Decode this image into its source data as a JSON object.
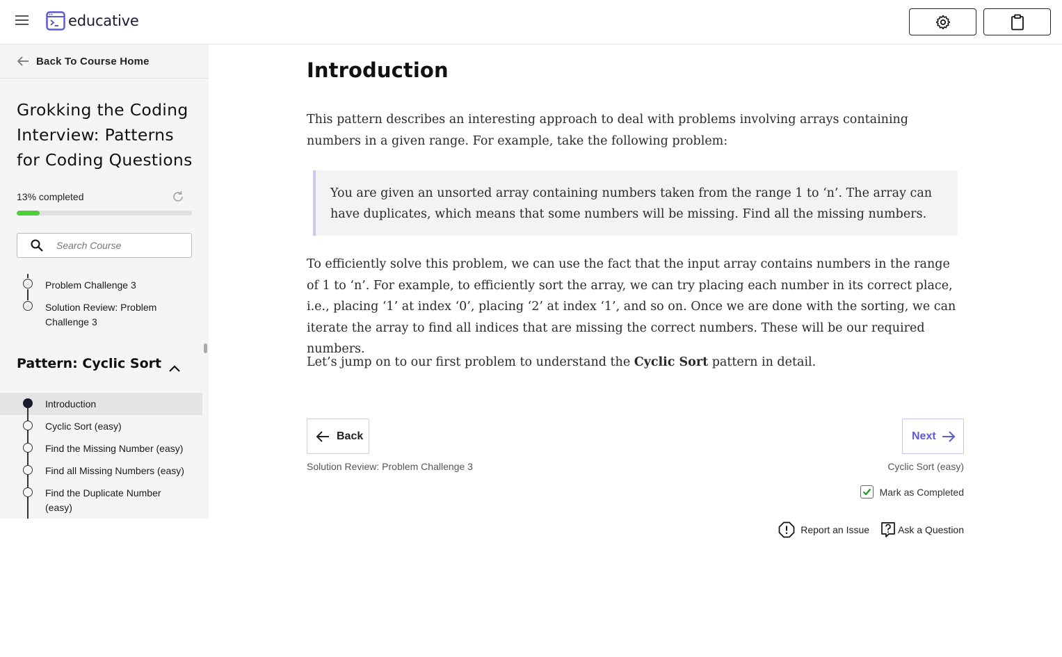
{
  "header": {
    "brand": "educative",
    "icons": [
      "menu-icon",
      "educative-logo",
      "gear-icon",
      "clipboard-icon"
    ]
  },
  "sidebar": {
    "back_label": "Back To Course Home",
    "course_title": "Grokking the Coding Interview: Patterns for Coding Questions",
    "progress_label": "13% completed",
    "progress_value": 0.13,
    "progress_color": "#4ecf3a",
    "search_placeholder": "Search Course",
    "prev_lessons": [
      {
        "label": "Problem Challenge 3"
      },
      {
        "label": "Solution Review: Problem Challenge 3"
      }
    ],
    "section_title": "Pattern: Cyclic Sort",
    "lessons": [
      {
        "label": "Introduction",
        "active": true
      },
      {
        "label": "Cyclic Sort (easy)"
      },
      {
        "label": "Find the Missing Number (easy)"
      },
      {
        "label": "Find all Missing Numbers (easy)"
      },
      {
        "label": "Find the Duplicate Number (easy)"
      }
    ]
  },
  "main": {
    "title": "Introduction",
    "para1": "This pattern describes an interesting approach to deal with problems involving arrays containing numbers in a given range. For example, take the following problem:",
    "quote": "You are given an unsorted array containing numbers taken from the range 1 to ‘n’. The array can have duplicates, which means that some numbers will be missing. Find all the missing numbers.",
    "para2": "To efficiently solve this problem, we can use the fact that the input array contains numbers in the range of 1 to ‘n’. For example, to efficiently sort the array, we can try placing each number in its correct place, i.e., placing ‘1’ at index ‘0’, placing ‘2’ at index ‘1’, and so on. Once we are done with the sorting, we can iterate the array to find all indices that are missing the correct numbers. These will be our required numbers.",
    "para3_before": "Let’s jump on to our first problem to understand the ",
    "para3_bold": "Cyclic Sort",
    "para3_after": " pattern in detail.",
    "back_label": "Back",
    "back_sub": "Solution Review: Problem Challenge 3",
    "next_label": "Next",
    "next_sub": "Cyclic Sort (easy)",
    "accent": "#5b5bd6",
    "mark_completed_label": "Mark as Completed",
    "mark_completed_checked": true,
    "report_label": "Report an Issue",
    "ask_label": "Ask a Question"
  }
}
